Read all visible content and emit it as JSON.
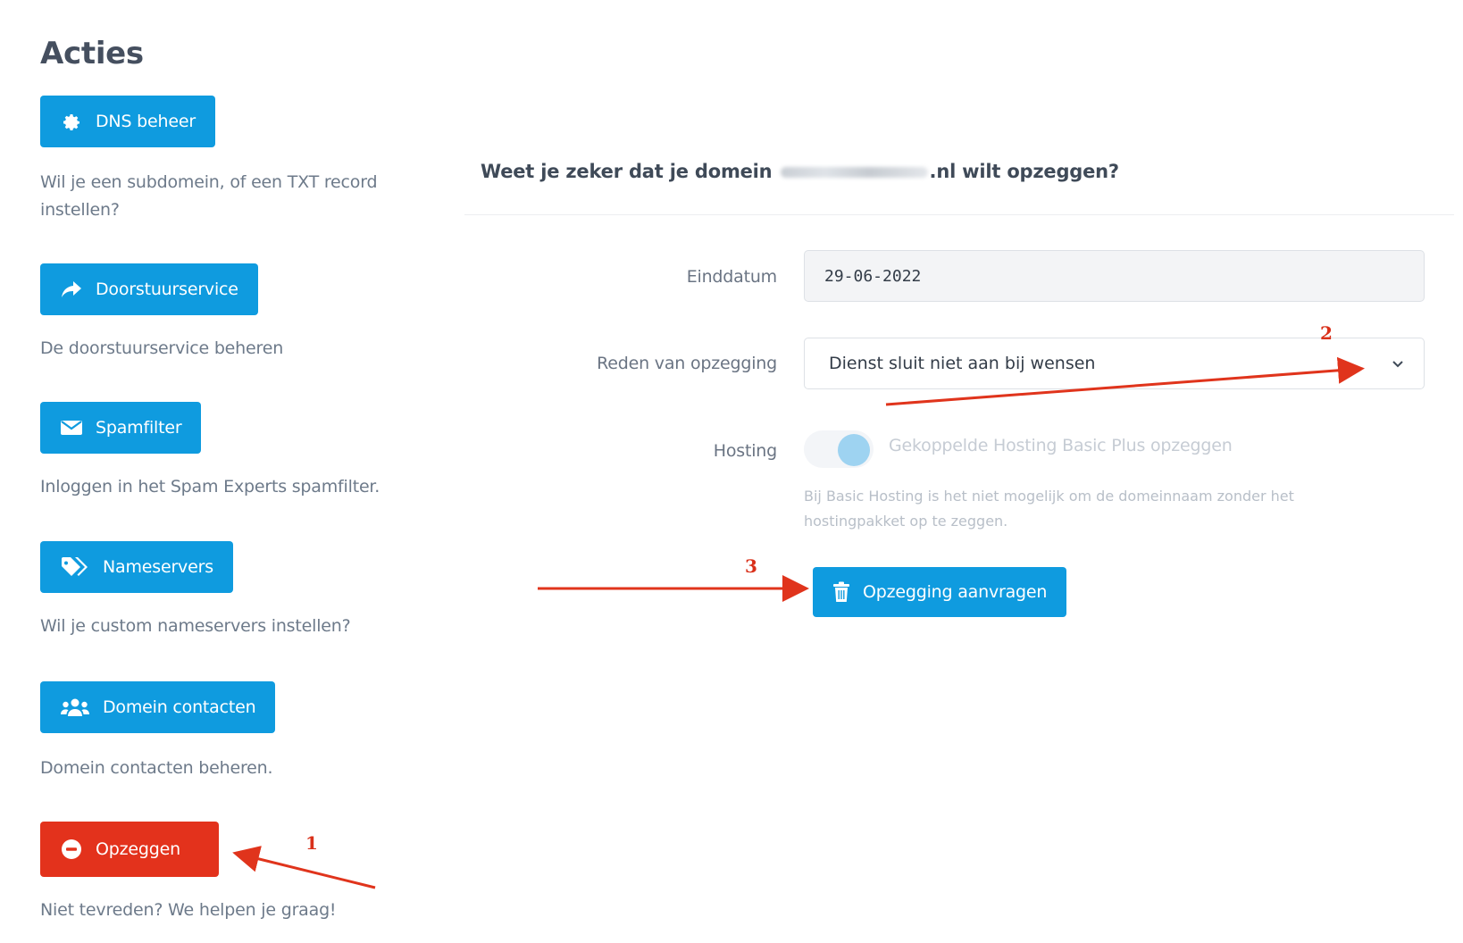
{
  "page_title": "Acties",
  "actions": [
    {
      "label": "DNS beheer",
      "icon": "gear-icon",
      "description": "Wil je een subdomein, of een TXT record instellen?"
    },
    {
      "label": "Doorstuurservice",
      "icon": "share-arrow-icon",
      "description": "De doorstuurservice beheren"
    },
    {
      "label": "Spamfilter",
      "icon": "envelope-icon",
      "description": "Inloggen in het Spam Experts spamfilter."
    },
    {
      "label": "Nameservers",
      "icon": "tags-icon",
      "description": "Wil je custom nameservers instellen?"
    },
    {
      "label": "Domein contacten",
      "icon": "users-icon",
      "description": "Domein contacten beheren."
    },
    {
      "label": "Opzeggen",
      "icon": "minus-circle-icon",
      "description": "Niet tevreden? We helpen je graag!"
    }
  ],
  "cancel_form": {
    "question_prefix": "Weet je zeker dat je domein",
    "question_suffix": ".nl wilt opzeggen?",
    "end_date_label": "Einddatum",
    "end_date_value": "29-06-2022",
    "reason_label": "Reden van opzegging",
    "reason_value": "Dienst sluit niet aan bij wensen",
    "hosting_label": "Hosting",
    "hosting_toggle_label": "Gekoppelde Hosting Basic Plus opzeggen",
    "hosting_toggle_on": true,
    "hosting_help": "Bij Basic Hosting is het niet mogelijk om de domeinnaam zonder het hostingpakket op te zeggen.",
    "submit_label": "Opzegging aanvragen"
  },
  "annotations": {
    "step1": "1",
    "step2": "2",
    "step3": "3"
  },
  "colors": {
    "primary": "#0f9bdf",
    "danger": "#e3321c",
    "annotation": "#d9301a"
  }
}
